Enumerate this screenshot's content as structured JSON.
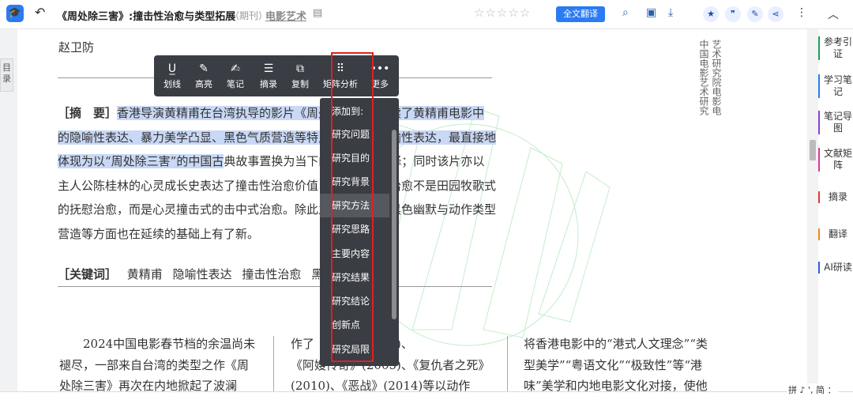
{
  "header": {
    "doc_title": "《周处除三害》:撞击性治愈与类型拓展",
    "doc_type": "（期刊）",
    "journal": "电影艺术",
    "stars": "☆☆☆☆☆",
    "translate_button": "全文翻译"
  },
  "sidebar": {
    "toc_tab": "目录"
  },
  "article": {
    "author": "赵卫防",
    "affiliation_col1": "中国电影艺术研究",
    "affiliation_col2": "艺术研究院电影电",
    "abstract_label": "［摘　要］",
    "abstract_highlighted": "香港导演黄精甫在台湾执导的影片《周处除三害》延续了黄精甫电影中的隐喻性表达、暴力美学凸显、黑色气质营造等特点。该片的隐喻性表达，最直接地体现为以“周处除三害”的中国古",
    "abstract_rest": "典故事置换为当下的某种社会选择；同时该片亦以主人公陈桂林的心灵成长史表达了撞击性治愈价值，只不过这种治愈不是田园牧歌式的抚慰治愈，而是心灵撞击式的击中式治愈。除此之外，该片在黑色幽默与动作类型营造等方面也在延续的基础上有了新。",
    "keywords_label": "［关键词］",
    "keywords": [
      "黄精甫",
      "隐喻性表达",
      "撞击性治愈",
      "黑色幽默"
    ],
    "body_col1": [
      "2024中国电影春节档的余温尚未",
      "褪尽，一部来自台湾的类型之作《周",
      "处除三害》再次在内地掀起了波澜"
    ],
    "body_col2": [
      "作了《江湖》(2004)、",
      "《阿嫂传奇》(2005)、《复仇者之死》",
      "(2010)、《恶战》(2014)等以动作"
    ],
    "body_col3": [
      "将香港电影中的“港式人文理念”“类",
      "型美学”“粤语文化”“极致性”等“港",
      "味”美学和内地电影文化对接，使他"
    ]
  },
  "toolbar": {
    "items": [
      {
        "label": "划线",
        "icon": "underline-icon",
        "glyph": "U̲"
      },
      {
        "label": "高亮",
        "icon": "highlight-pen-icon",
        "glyph": "✎"
      },
      {
        "label": "笔记",
        "icon": "note-icon",
        "glyph": "✍"
      },
      {
        "label": "摘录",
        "icon": "excerpt-icon",
        "glyph": "☰"
      },
      {
        "label": "复制",
        "icon": "copy-icon",
        "glyph": "⧉"
      },
      {
        "label": "矩阵分析",
        "icon": "grid-icon",
        "glyph": "⠿"
      },
      {
        "label": "更多",
        "icon": "more-dots-icon",
        "glyph": "•••"
      }
    ]
  },
  "dropdown": {
    "header": "添加到:",
    "items": [
      "研究问题",
      "研究目的",
      "研究背景",
      "研究方法",
      "研究思路",
      "主要内容",
      "研究结果",
      "研究结论",
      "创新点",
      "研究局限"
    ],
    "hovered": "研究方法"
  },
  "right_panel": {
    "items": [
      {
        "label": "参考引证",
        "color": "#1e9e5a"
      },
      {
        "label": "学习笔记",
        "color": "#2b7bf3"
      },
      {
        "label": "笔记导图",
        "color": "#8b3fd9"
      },
      {
        "label": "文献矩阵",
        "color": "#d83b9a"
      },
      {
        "label": "摘录",
        "color": "#e03a3a"
      },
      {
        "label": "翻译",
        "color": "#f08a1c"
      },
      {
        "label": "AI研读",
        "color": "#2b5fe0"
      }
    ]
  },
  "status": {
    "ime": "拼 ♪ ', 简 ："
  },
  "colors": {
    "accent": "#2b7bf3",
    "highlight": "#c8d8f5",
    "annotation_box": "#e02020",
    "toolbar_bg": "#3a3d44"
  }
}
